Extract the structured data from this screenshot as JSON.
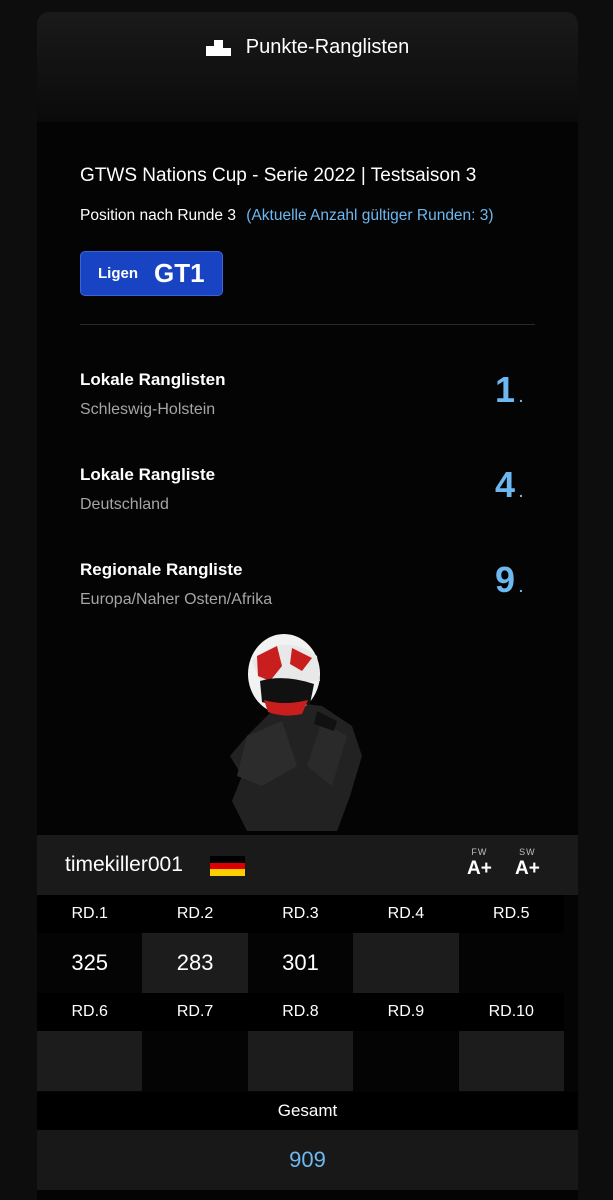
{
  "header": {
    "title": "Punkte-Ranglisten",
    "icon": "podium-icon"
  },
  "event": {
    "title": "GTWS Nations Cup - Serie 2022 | Testsaison 3",
    "position_label": "Position nach Runde 3",
    "valid_rounds_hint": "(Aktuelle Anzahl gültiger Runden: 3)"
  },
  "league": {
    "label": "Ligen",
    "value": "GT1"
  },
  "rankings": [
    {
      "title": "Lokale Ranglisten",
      "subtitle": "Schleswig-Holstein",
      "rank": "1",
      "suffix": "."
    },
    {
      "title": "Lokale Rangliste",
      "subtitle": "Deutschland",
      "rank": "4",
      "suffix": "."
    },
    {
      "title": "Regionale Rangliste",
      "subtitle": "Europa/Naher Osten/Afrika",
      "rank": "9",
      "suffix": "."
    }
  ],
  "player": {
    "name": "timekiller001",
    "flag_colors": [
      "#000000",
      "#dd0000",
      "#ffce00"
    ],
    "grades": [
      {
        "label": "FW",
        "value": "A+"
      },
      {
        "label": "SW",
        "value": "A+"
      }
    ]
  },
  "rounds": {
    "row1": {
      "labels": [
        "RD.1",
        "RD.2",
        "RD.3",
        "RD.4",
        "RD.5"
      ],
      "values": [
        "325",
        "283",
        "301",
        "",
        ""
      ]
    },
    "row2": {
      "labels": [
        "RD.6",
        "RD.7",
        "RD.8",
        "RD.9",
        "RD.10"
      ],
      "values": [
        "",
        "",
        "",
        "",
        ""
      ]
    }
  },
  "total": {
    "label": "Gesamt",
    "value": "909"
  },
  "colors": {
    "accent": "#6db8f0",
    "button": "#1844c4"
  }
}
